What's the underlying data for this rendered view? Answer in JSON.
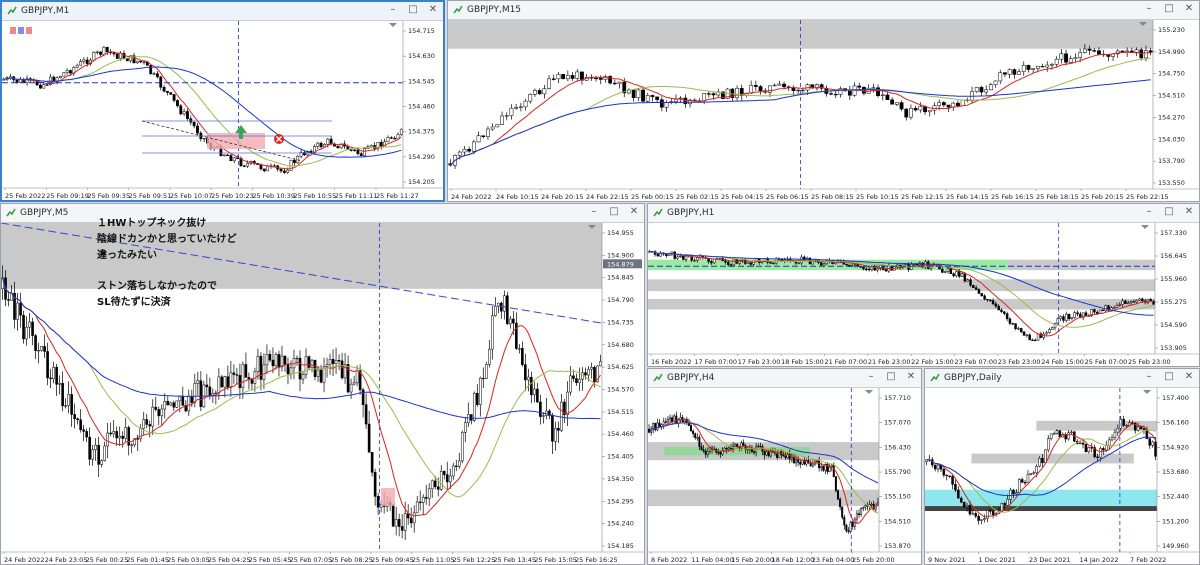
{
  "windows": {
    "m1": {
      "title": "GBPJPY,M1",
      "prices": [
        "154.715",
        "154.630",
        "154.545",
        "154.460",
        "154.375",
        "154.290",
        "154.205"
      ],
      "times": [
        "25 Feb 2022",
        "25 Feb 09:19",
        "25 Feb 09:35",
        "25 Feb 09:51",
        "25 Feb 10:07",
        "25 Feb 10:23",
        "25 Feb 10:39",
        "25 Feb 10:55",
        "25 Feb 11:11",
        "25 Feb 11:27"
      ]
    },
    "m15": {
      "title": "GBPJPY,M15",
      "prices": [
        "155.230",
        "154.990",
        "154.750",
        "154.510",
        "154.270",
        "154.030",
        "153.790",
        "153.550"
      ],
      "times": [
        "24 Feb 2022",
        "24 Feb 10:15",
        "24 Feb 20:15",
        "24 Feb 22:15",
        "25 Feb 00:15",
        "25 Feb 02:15",
        "25 Feb 04:15",
        "25 Feb 06:15",
        "25 Feb 08:15",
        "25 Feb 10:15",
        "25 Feb 12:15",
        "25 Feb 14:15",
        "25 Feb 16:15",
        "25 Feb 18:15",
        "25 Feb 20:15",
        "25 Feb 22:15"
      ]
    },
    "m5": {
      "title": "GBPJPY,M5",
      "prices": [
        "154.955",
        "154.900",
        "154.845",
        "154.790",
        "154.735",
        "154.680",
        "154.625",
        "154.570",
        "154.515",
        "154.460",
        "154.405",
        "154.350",
        "154.295",
        "154.240",
        "154.185"
      ],
      "current_price": "154.879",
      "times": [
        "24 Feb 2022",
        "24 Feb 23:05",
        "25 Feb 00:25",
        "25 Feb 01:45",
        "25 Feb 03:05",
        "25 Feb 04:25",
        "25 Feb 05:45",
        "25 Feb 07:05",
        "25 Feb 08:25",
        "25 Feb 09:45",
        "25 Feb 11:05",
        "25 Feb 12:25",
        "25 Feb 13:45",
        "25 Feb 15:05",
        "25 Feb 16:25"
      ],
      "notes": [
        "１HWトップネック抜け",
        "陰線ドカンかと思っていたけど",
        "違ったみたい",
        "ストン落ちしなかったので",
        "SL待たずに決済"
      ]
    },
    "h1": {
      "title": "GBPJPY,H1",
      "prices": [
        "157.330",
        "156.645",
        "155.960",
        "155.275",
        "154.590",
        "153.905"
      ],
      "times": [
        "16 Feb 2022",
        "17 Feb 07:00",
        "17 Feb 23:00",
        "18 Feb 15:00",
        "21 Feb 07:00",
        "21 Feb 23:00",
        "22 Feb 15:00",
        "23 Feb 07:00",
        "23 Feb 23:00",
        "24 Feb 15:00",
        "25 Feb 07:00",
        "25 Feb 23:00"
      ]
    },
    "h4": {
      "title": "GBPJPY,H4",
      "prices": [
        "157.710",
        "157.070",
        "156.430",
        "155.790",
        "155.150",
        "154.510",
        "153.870"
      ],
      "times": [
        "8 Feb 2022",
        "11 Feb 04:00",
        "15 Feb 20:00",
        "18 Feb 12:00",
        "23 Feb 04:00",
        "25 Feb 20:00"
      ]
    },
    "daily": {
      "title": "GBPJPY,Daily",
      "prices": [
        "157.400",
        "156.160",
        "154.920",
        "153.680",
        "152.440",
        "151.200",
        "149.960"
      ],
      "times": [
        "9 Nov 2021",
        "1 Dec 2021",
        "23 Dec 2021",
        "14 Jan 2022",
        "7 Feb 2022"
      ]
    }
  },
  "colors": {
    "bull": "#ffffff",
    "bear": "#000000",
    "ma_fast": "#e0231b",
    "ma_mid": "#9cbd4a",
    "ma_slow": "#1a33d1",
    "zone": "#c9c9c9",
    "green_zone": "#74e07b",
    "cyan_zone": "#8fe6ee",
    "accent": "#3b7fd0"
  },
  "icons": {
    "window": "chart-window-icon",
    "minimize": "minimize-icon",
    "maximize": "maximize-icon",
    "close": "close-icon"
  }
}
